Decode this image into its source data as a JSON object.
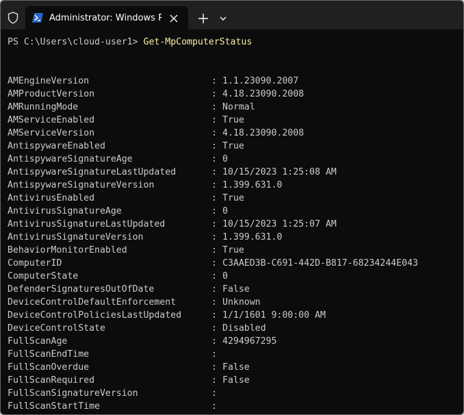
{
  "tab": {
    "title": "Administrator: Windows PowerShell"
  },
  "icons": {
    "shield": "shield-icon",
    "powershell": "powershell-icon",
    "close": "close-icon",
    "new_tab": "plus-icon",
    "dropdown": "chevron-down-icon"
  },
  "colors": {
    "terminal_bg": "#0c0c0c",
    "text": "#cccccc",
    "command": "#f9f1a5",
    "titlebar": "#202020"
  },
  "terminal": {
    "prompt": "PS C:\\Users\\cloud-user1> ",
    "command": "Get-MpComputerStatus",
    "separator": ":",
    "rows": [
      {
        "key": "AMEngineVersion",
        "value": "1.1.23090.2007"
      },
      {
        "key": "AMProductVersion",
        "value": "4.18.23090.2008"
      },
      {
        "key": "AMRunningMode",
        "value": "Normal"
      },
      {
        "key": "AMServiceEnabled",
        "value": "True"
      },
      {
        "key": "AMServiceVersion",
        "value": "4.18.23090.2008"
      },
      {
        "key": "AntispywareEnabled",
        "value": "True"
      },
      {
        "key": "AntispywareSignatureAge",
        "value": "0"
      },
      {
        "key": "AntispywareSignatureLastUpdated",
        "value": "10/15/2023 1:25:08 AM"
      },
      {
        "key": "AntispywareSignatureVersion",
        "value": "1.399.631.0"
      },
      {
        "key": "AntivirusEnabled",
        "value": "True"
      },
      {
        "key": "AntivirusSignatureAge",
        "value": "0"
      },
      {
        "key": "AntivirusSignatureLastUpdated",
        "value": "10/15/2023 1:25:07 AM"
      },
      {
        "key": "AntivirusSignatureVersion",
        "value": "1.399.631.0"
      },
      {
        "key": "BehaviorMonitorEnabled",
        "value": "True"
      },
      {
        "key": "ComputerID",
        "value": "C3AAED3B-C691-442D-B817-68234244E043"
      },
      {
        "key": "ComputerState",
        "value": "0"
      },
      {
        "key": "DefenderSignaturesOutOfDate",
        "value": "False"
      },
      {
        "key": "DeviceControlDefaultEnforcement",
        "value": "Unknown"
      },
      {
        "key": "DeviceControlPoliciesLastUpdated",
        "value": "1/1/1601 9:00:00 AM"
      },
      {
        "key": "DeviceControlState",
        "value": "Disabled"
      },
      {
        "key": "FullScanAge",
        "value": "4294967295"
      },
      {
        "key": "FullScanEndTime",
        "value": ""
      },
      {
        "key": "FullScanOverdue",
        "value": "False"
      },
      {
        "key": "FullScanRequired",
        "value": "False"
      },
      {
        "key": "FullScanSignatureVersion",
        "value": ""
      },
      {
        "key": "FullScanStartTime",
        "value": ""
      }
    ]
  }
}
